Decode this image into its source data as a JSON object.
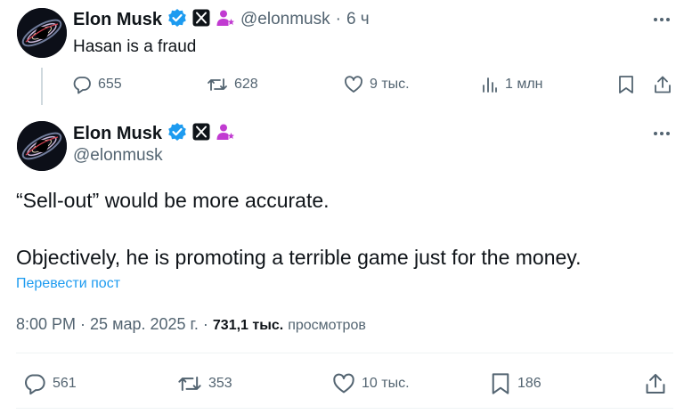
{
  "tweet1": {
    "name": "Elon Musk",
    "handle": "@elonmusk",
    "separator": "·",
    "time": "6 ч",
    "text": "Hasan is a fraud",
    "replies": "655",
    "reposts": "628",
    "likes": "9 тыс.",
    "views": "1 млн"
  },
  "tweet2": {
    "name": "Elon Musk",
    "handle": "@elonmusk",
    "line1": "“Sell-out” would be more accurate.",
    "line2": "Objectively, he is promoting a terrible game just for the money.",
    "translate": "Перевести пост",
    "time": "8:00 PM",
    "dot1": "·",
    "date": "25 мар. 2025 г.",
    "dot2": "·",
    "views_count": "731,1 тыс.",
    "views_label": "просмотров",
    "replies": "561",
    "reposts": "353",
    "likes": "10 тыс.",
    "bookmarks": "186"
  },
  "colors": {
    "verified": "#1d9bf0",
    "affiliate": "#c13bd1",
    "link": "#1d9bf0",
    "secondary_text": "#536471"
  },
  "icons": [
    "verified-badge-icon",
    "x-logo-badge-icon",
    "affiliate-person-icon",
    "more-icon",
    "reply-icon",
    "repost-icon",
    "like-icon",
    "views-icon",
    "bookmark-icon",
    "share-icon"
  ]
}
